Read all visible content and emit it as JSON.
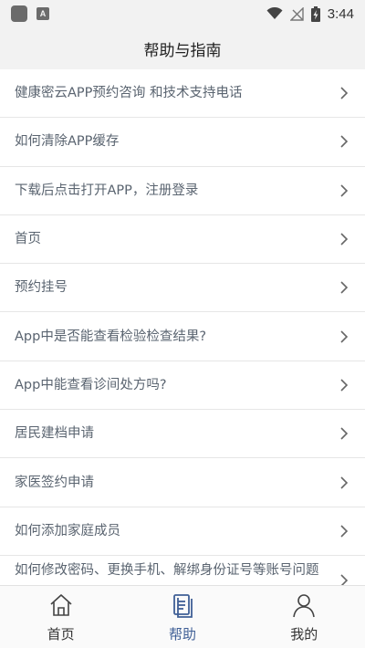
{
  "status_bar": {
    "time": "3:44",
    "notification_icon_letter": "A",
    "icons": [
      "app-notification-icon",
      "a-notification-icon",
      "wifi-icon",
      "no-signal-icon",
      "battery-charging-icon"
    ]
  },
  "header": {
    "title": "帮助与指南"
  },
  "help_items": [
    {
      "label": "健康密云APP预约咨询 和技术支持电话"
    },
    {
      "label": "如何清除APP缓存"
    },
    {
      "label": "下载后点击打开APP，注册登录"
    },
    {
      "label": "首页"
    },
    {
      "label": "预约挂号"
    },
    {
      "label": "App中是否能查看检验检查结果?"
    },
    {
      "label": "App中能查看诊间处方吗?"
    },
    {
      "label": "居民建档申请"
    },
    {
      "label": "家医签约申请"
    },
    {
      "label": "如何添加家庭成员"
    },
    {
      "label": "如何修改密码、更换手机、解绑身份证号等账号问题"
    }
  ],
  "tab_bar": {
    "tabs": [
      {
        "label": "首页",
        "icon": "home-icon",
        "active": false
      },
      {
        "label": "帮助",
        "icon": "document-icon",
        "active": true
      },
      {
        "label": "我的",
        "icon": "person-icon",
        "active": false
      }
    ]
  },
  "colors": {
    "active_tab": "#3f5f96",
    "list_text": "#5a6470",
    "header_bg": "#f2f2f2"
  }
}
